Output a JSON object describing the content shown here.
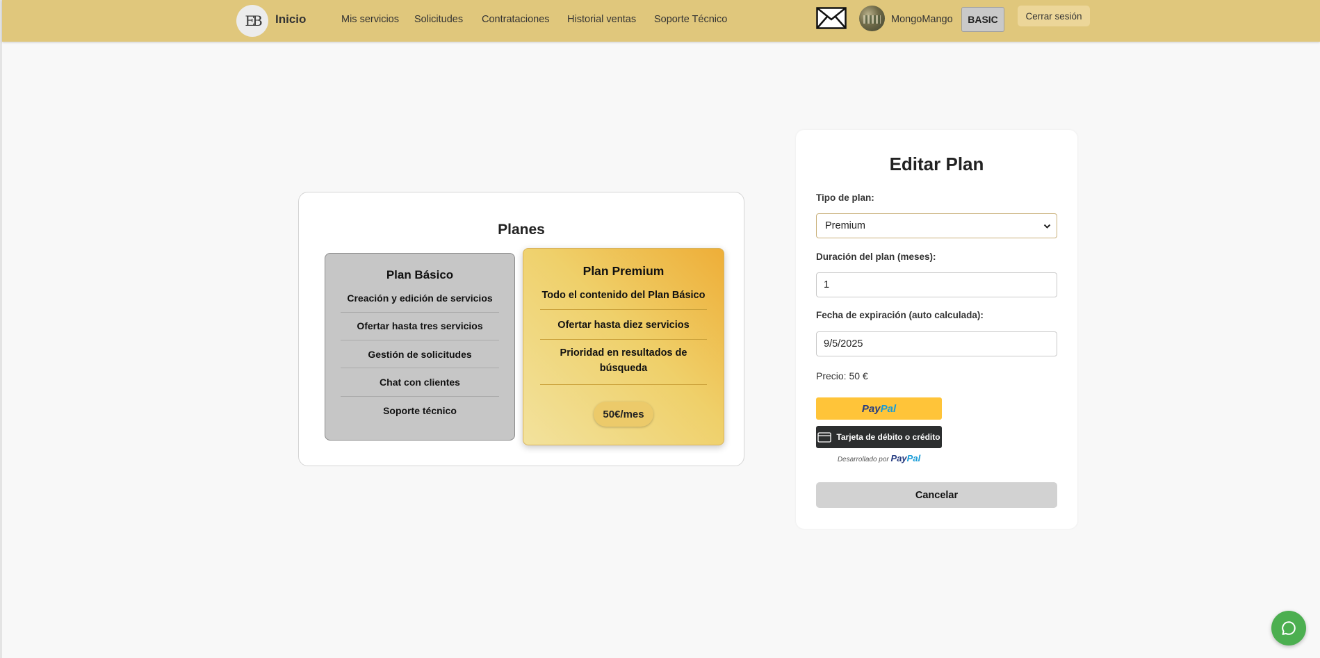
{
  "navbar": {
    "logo_text": "EB",
    "brand": "Inicio",
    "links": [
      "Mis servicios",
      "Solicitudes",
      "Contrataciones",
      "Historial ventas",
      "Soporte Técnico"
    ],
    "username": "MongoMango",
    "plan_badge": "BASIC",
    "logout_label": "Cerrar sesión",
    "icons": [
      "mail-icon",
      "avatar"
    ]
  },
  "plans": {
    "title": "Planes",
    "basic": {
      "name": "Plan Básico",
      "features": [
        "Creación y edición de servicios",
        "Ofertar hasta tres servicios",
        "Gestión de solicitudes",
        "Chat con clientes",
        "Soporte técnico"
      ]
    },
    "premium": {
      "name": "Plan Premium",
      "features": [
        "Todo el contenido del Plan Básico",
        "Ofertar hasta diez servicios",
        "Prioridad en resultados de búsqueda"
      ],
      "price": "50€/mes"
    }
  },
  "edit_plan": {
    "title": "Editar Plan",
    "plan_type_label": "Tipo de plan:",
    "plan_type_value": "Premium",
    "duration_label": "Duración del plan (meses):",
    "duration_value": "1",
    "expiration_label": "Fecha de expiración (auto calculada):",
    "expiration_value": "9/5/2025",
    "price_text": "Precio: 50 €",
    "paypal_label_a": "Pay",
    "paypal_label_b": "Pal",
    "card_label": "Tarjeta de débito o crédito",
    "powered_by": "Desarrollado por",
    "powered_logo_a": "Pay",
    "powered_logo_b": "Pal",
    "cancel_label": "Cancelar"
  },
  "colors": {
    "navbar": "#e0c77c",
    "basic_card": "#c6c6c6",
    "premium_gradient_start": "#f2e29d",
    "premium_gradient_end": "#eeae38",
    "paypal_yellow": "#ffc439",
    "card_button": "#2c2e2f",
    "chat_fab": "#4caf50"
  },
  "chat": {
    "icon": "chat-bubble-icon"
  }
}
